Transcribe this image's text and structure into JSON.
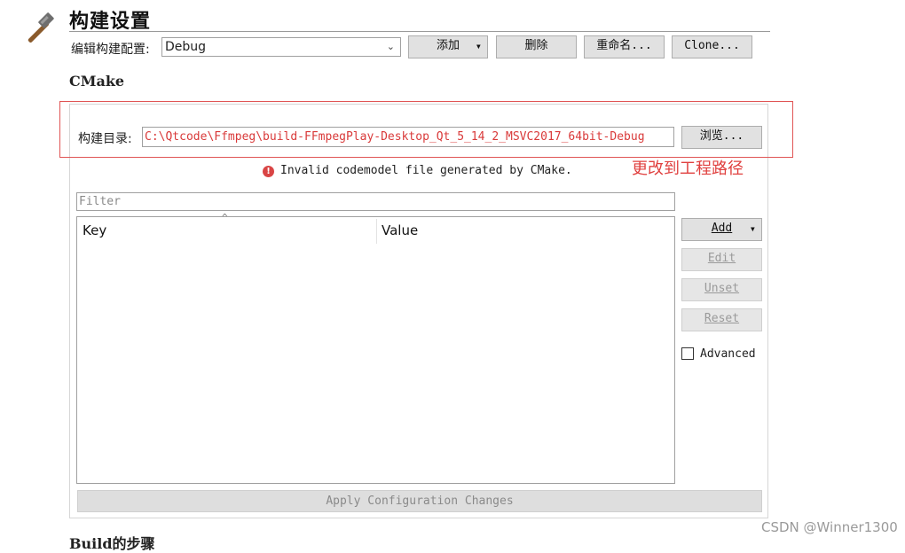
{
  "page": {
    "title": "构建设置"
  },
  "config": {
    "label": "编辑构建配置:",
    "selected": "Debug",
    "add_label": "添加",
    "delete_label": "删除",
    "rename_label": "重命名...",
    "clone_label": "Clone..."
  },
  "cmake": {
    "heading": "CMake",
    "build_dir_label": "构建目录:",
    "build_dir_value": "C:\\Qtcode\\Ffmpeg\\build-FFmpegPlay-Desktop_Qt_5_14_2_MSVC2017_64bit-Debug",
    "browse_label": "浏览...",
    "annotation": "更改到工程路径",
    "error_message": "Invalid codemodel file generated by CMake.",
    "filter_placeholder": "Filter",
    "columns": [
      "Key",
      "Value"
    ],
    "side_buttons": {
      "add": "Add",
      "edit": "Edit",
      "unset": "Unset",
      "reset": "Reset"
    },
    "advanced_label": "Advanced",
    "apply_label": "Apply Configuration Changes"
  },
  "next_section": {
    "heading": "Build的步骤"
  },
  "watermark": "CSDN @Winner1300",
  "colors": {
    "annotation_red": "#e0403f",
    "path_red": "#d93a3a",
    "error_icon": "#d94545"
  }
}
